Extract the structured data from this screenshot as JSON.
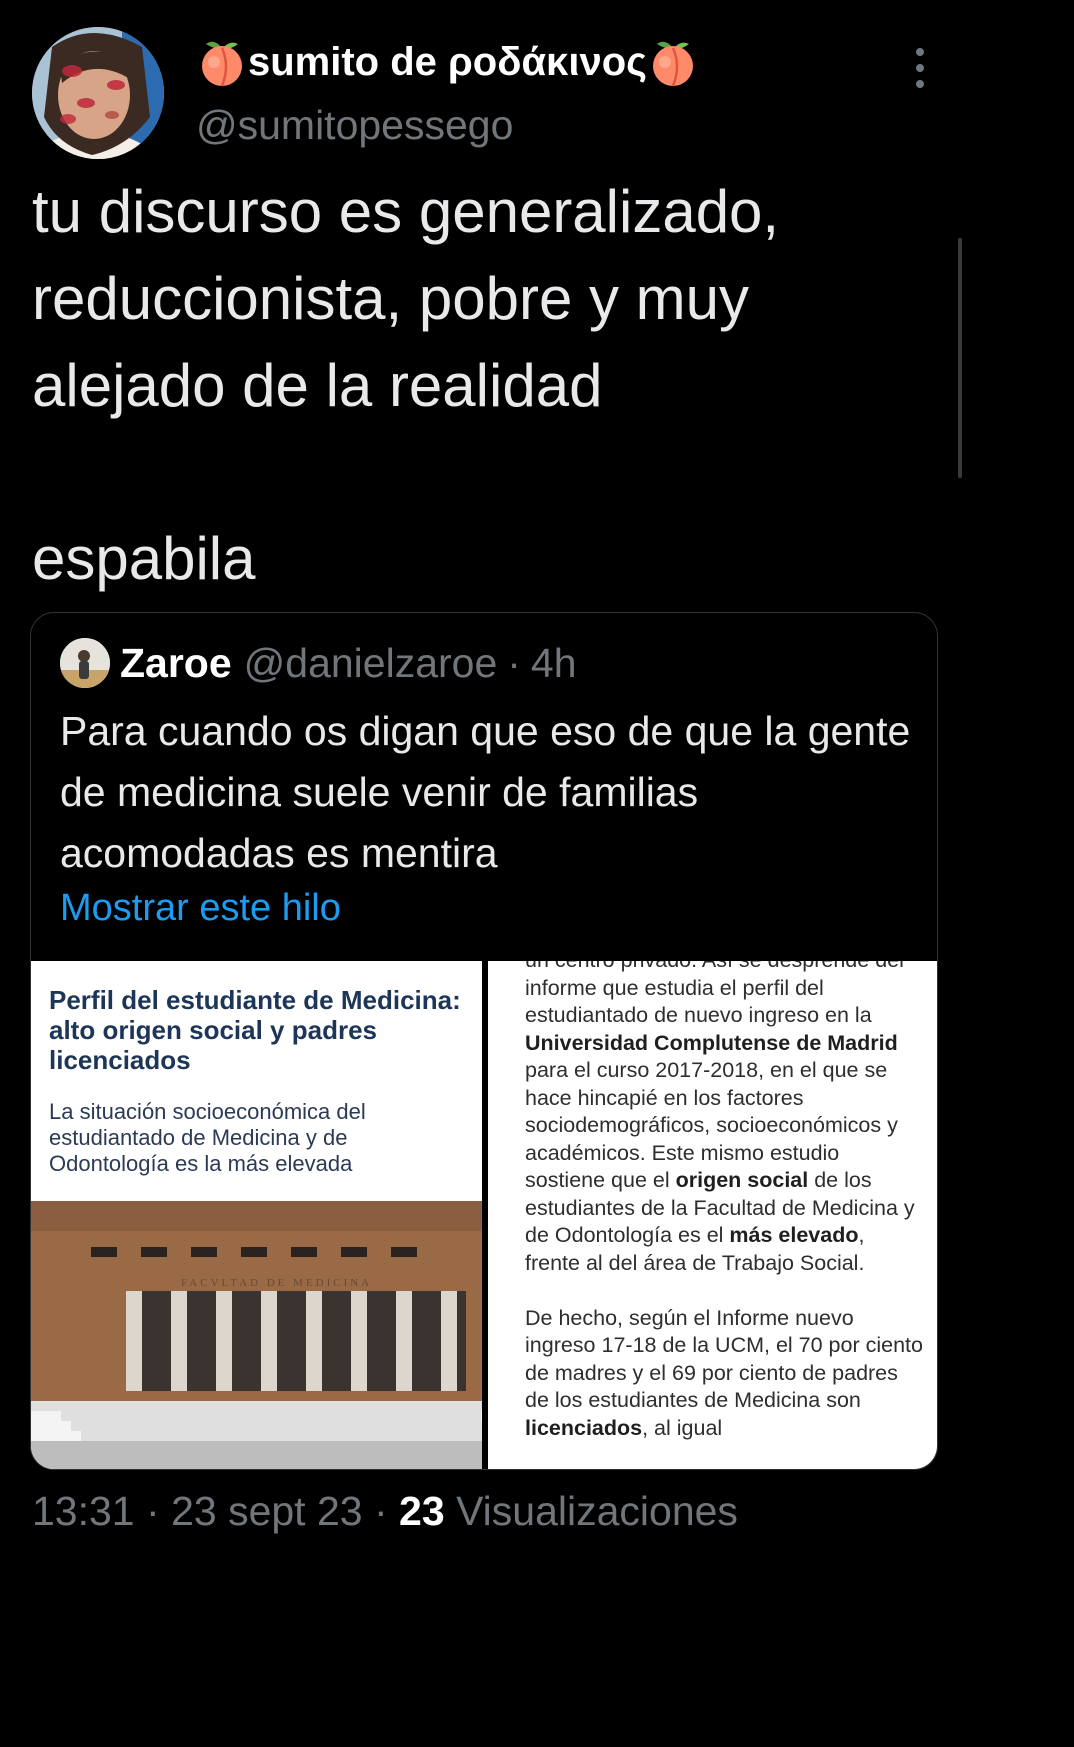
{
  "author": {
    "display_name": "sumito de ροδάκινος",
    "handle": "@sumitopessego",
    "name_emoji": "peach-emoji"
  },
  "tweet": {
    "lines": [
      "tu discurso es generalizado,",
      "reduccionista, pobre y muy",
      "alejado de la realidad"
    ],
    "extra": "espabila"
  },
  "quoted": {
    "name": "Zaroe",
    "handle": "@danielzaroe",
    "separator": "·",
    "time": "4h",
    "text": "Para cuando os digan que eso de que la gente de medicina suele venir de familias acomodadas es mentira",
    "show_thread": "Mostrar este hilo"
  },
  "media_left": {
    "title": "Perfil del estudiante de Medicina: alto origen social y padres licenciados",
    "subtitle": "La situación socioeconómica del estudiantado de Medicina y de Odontología es la más elevada",
    "building_inscription": "FACVLTAD DE MEDICINA"
  },
  "media_right": {
    "para1_pre": "un centro privado. Así se desprende del informe que estudia el perfil del estudiantado de nuevo ingreso en la ",
    "para1_bold1": "Universidad Complutense de Madrid",
    "para1_mid1": " para el curso 2017-2018, en el que se hace hincapié en los factores sociodemográficos, socioeconómicos y académicos. Este mismo estudio sostiene que el ",
    "para1_bold2": "origen social",
    "para1_mid2": " de los estudiantes de la Facultad de Medicina y de Odontología es el ",
    "para1_bold3": "más elevado",
    "para1_end": ", frente al del área de Trabajo Social.",
    "para2_pre": "De hecho, según el Informe nuevo ingreso 17-18 de la UCM, el 70 por ciento de madres y el 69 por ciento de padres de los estudiantes de Medicina son ",
    "para2_bold": "licenciados",
    "para2_end": ", al igual"
  },
  "footer": {
    "time": "13:31",
    "sep1": "·",
    "date": "23 sept 23",
    "sep2": "·",
    "views_count": "23",
    "views_label": "Visualizaciones"
  },
  "colors": {
    "background": "#000000",
    "text": "#e7e9ea",
    "muted": "#71767b",
    "link": "#1d9bf0",
    "border": "#2f3336"
  }
}
